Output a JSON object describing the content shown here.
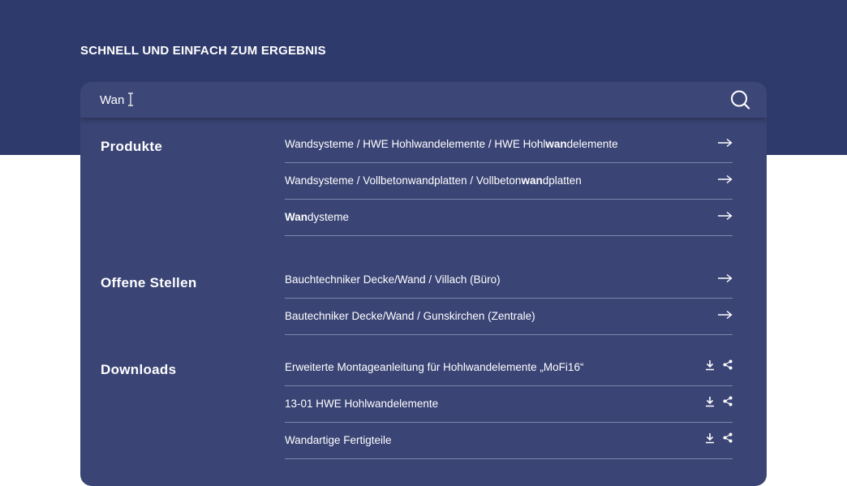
{
  "hero": {
    "title": "SCHNELL UND EINFACH ZUM ERGEBNIS"
  },
  "search": {
    "value": "Wan",
    "icon": "search-icon"
  },
  "sections": {
    "produkte": {
      "title": "Produkte",
      "items": [
        {
          "pre": "Wandsysteme / HWE Hohlwandelemente / HWE Hohl",
          "match": "wan",
          "post": "delemente",
          "icon": "arrow-right-icon"
        },
        {
          "pre": "Wandsysteme / Vollbetonwandplatten / Vollbeton",
          "match": "wan",
          "post": "dplatten",
          "icon": "arrow-right-icon"
        },
        {
          "pre": "",
          "match": "Wan",
          "post": "dysteme",
          "icon": "arrow-right-icon"
        }
      ]
    },
    "stellen": {
      "title": "Offene Stellen",
      "items": [
        {
          "label": "Bauchtechniker Decke/Wand / Villach (Büro)",
          "icon": "arrow-right-icon"
        },
        {
          "label": "Bautechniker Decke/Wand / Gunskirchen (Zentrale)",
          "icon": "arrow-right-icon"
        }
      ]
    },
    "downloads": {
      "title": "Downloads",
      "items": [
        {
          "label": "Erweiterte Montageanleitung für Hohlwandelemente „MoFi16“",
          "icons": [
            "download-icon",
            "share-icon"
          ]
        },
        {
          "label": "13-01 HWE Hohlwandelemente",
          "icons": [
            "download-icon",
            "share-icon"
          ]
        },
        {
          "label": "Wandartige Fertigteile",
          "icons": [
            "download-icon",
            "share-icon"
          ]
        }
      ]
    }
  },
  "colors": {
    "hero_background": "#2f3a6c",
    "panel_background": "#3a4475",
    "divider": "#7e86ad",
    "text": "#ffffff"
  }
}
